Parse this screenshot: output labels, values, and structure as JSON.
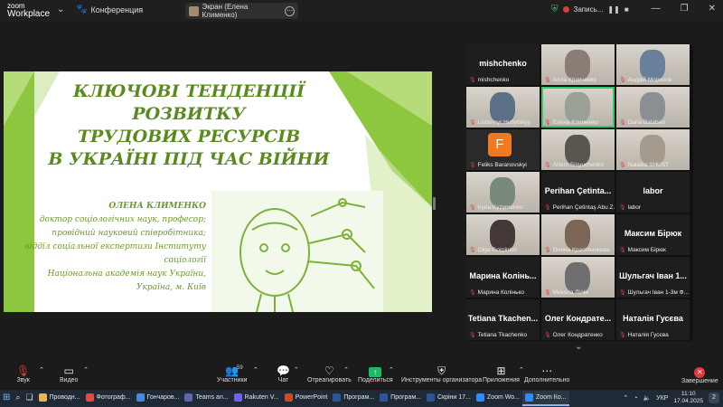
{
  "app": {
    "logo_line1": "zoom",
    "logo_line2": "Workplace",
    "meeting_label": "Конференция"
  },
  "screen_share": {
    "label": "Экран (Елена Клименко)"
  },
  "recording": {
    "label": "Запись..."
  },
  "slide": {
    "title_lines": [
      "КЛЮЧОВІ ТЕНДЕНЦІЇ",
      "РОЗВИТКУ",
      "ТРУДОВИХ РЕСУРСІВ",
      "В УКРАЇНІ ПІД ЧАС ВІЙНИ"
    ],
    "author_lines": [
      "ОЛЕНА КЛИМЕНКО",
      "доктор соціологічних наук, професор;",
      "провідний науковий співробітника;",
      "відділ соціальної експертизи Інституту соціології",
      "Національна академія наук України,",
      "Україна, м. Київ"
    ],
    "accent": "#8dc63f"
  },
  "gallery": {
    "tiles": [
      {
        "name": "mishchenko",
        "big": "mishchenko",
        "type": "name"
      },
      {
        "name": "Алла Кравченко",
        "type": "photo",
        "color": "#8b7d75"
      },
      {
        "name": "Андрій Морозов",
        "type": "photo",
        "color": "#6a7f9a"
      },
      {
        "name": "Liubomyr Hubytskyy",
        "type": "photo",
        "color": "#5b6f86"
      },
      {
        "name": "Елена Клименко",
        "type": "photo",
        "color": "#9aa097",
        "active": true
      },
      {
        "name": "Daria Balaban",
        "type": "photo",
        "color": "#8a8f94"
      },
      {
        "name": "Feliks Baranovskyi",
        "type": "letter",
        "letter": "F"
      },
      {
        "name": "Artem Sinyuchenko",
        "type": "photo",
        "color": "#5a5550"
      },
      {
        "name": "Nataliia SHUST",
        "type": "photo",
        "color": "#a49a8e"
      },
      {
        "name": "Iryna Kyzymenko",
        "type": "photo",
        "color": "#7a8a7a"
      },
      {
        "name": "Perihan Çetintaş Abu Z...",
        "big": "Perihan  Çetinta...",
        "type": "name"
      },
      {
        "name": "labor",
        "big": "labor",
        "type": "name"
      },
      {
        "name": "Olga Gorpinich",
        "type": "photo",
        "color": "#443838"
      },
      {
        "name": "Олена Красільнікова",
        "type": "photo",
        "color": "#7a6556"
      },
      {
        "name": "Максим Бірюк",
        "big": "Максим Бірюк",
        "type": "name"
      },
      {
        "name": "Марина Колінько",
        "big": "Марина  Колінь...",
        "type": "name"
      },
      {
        "name": "Микола Лілін",
        "type": "photo",
        "color": "#6e6e6e"
      },
      {
        "name": "Шульгач Іван 1-3м Ф...",
        "big": "Шульгач Іван 1...",
        "type": "name"
      },
      {
        "name": "Tetiana Tkachenko",
        "big": "Tetiana  Tkachen...",
        "type": "name"
      },
      {
        "name": "Олег Кондратенко",
        "big": "Олег  Кондрате...",
        "type": "name"
      },
      {
        "name": "Наталія Гусєва",
        "big": "Наталія Гусєва",
        "type": "name"
      }
    ]
  },
  "toolbar": {
    "audio": "Звук",
    "video": "Видео",
    "participants": "Участники",
    "participants_count": "59",
    "chat": "Чат",
    "react": "Отреагировать",
    "share": "Поделиться",
    "host_tools": "Инструменты организатора",
    "apps": "Приложения",
    "more": "Дополнительно",
    "end": "Завершение"
  },
  "taskbar": {
    "items": [
      {
        "label": "Проводн...",
        "color": "#e8b84a"
      },
      {
        "label": "Фотограф...",
        "color": "#e34c3c"
      },
      {
        "label": "Гончаров...",
        "color": "#3c8de3"
      },
      {
        "label": "Teams an...",
        "color": "#6264a7"
      },
      {
        "label": "Rakuten V...",
        "color": "#7360f2"
      },
      {
        "label": "PowerPoint",
        "color": "#d24726"
      },
      {
        "label": "Програм...",
        "color": "#2b579a"
      },
      {
        "label": "Програм...",
        "color": "#2b579a"
      },
      {
        "label": "Скріни 17...",
        "color": "#2b579a"
      },
      {
        "label": "Zoom Wo...",
        "color": "#2d8cff"
      },
      {
        "label": "Zoom Ко...",
        "color": "#2d8cff",
        "active": true
      }
    ],
    "lang": "УКР",
    "time": "11:10",
    "date": "17.04.2025",
    "notif": "2"
  }
}
